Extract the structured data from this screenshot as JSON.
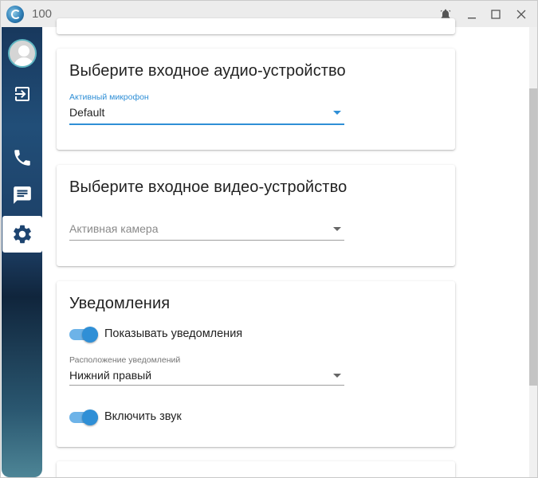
{
  "window": {
    "title": "100",
    "controls": [
      "bell-icon",
      "minimize-icon",
      "maximize-icon",
      "close-icon"
    ]
  },
  "sidebar": {
    "items": [
      {
        "name": "avatar",
        "icon": "user-avatar-icon"
      },
      {
        "name": "logout",
        "icon": "logout-icon"
      },
      {
        "name": "calls",
        "icon": "phone-icon"
      },
      {
        "name": "messages",
        "icon": "chat-icon"
      },
      {
        "name": "settings",
        "icon": "gear-icon",
        "active": true
      }
    ]
  },
  "audio": {
    "title": "Выберите входное аудио-устройство",
    "field_label": "Активный микрофон",
    "value": "Default"
  },
  "video": {
    "title": "Выберите входное видео-устройство",
    "placeholder": "Активная камера"
  },
  "notifications": {
    "title": "Уведомления",
    "show_label": "Показывать уведомления",
    "show_enabled": true,
    "position_label": "Расположение уведомлений",
    "position_value": "Нижний правый",
    "sound_label": "Включить звук",
    "sound_enabled": true
  },
  "colors": {
    "accent": "#2f8fd6",
    "toggle_track": "#6db3e8",
    "sidebar_top": "#18385d",
    "sidebar_bottom": "#4d8596"
  }
}
